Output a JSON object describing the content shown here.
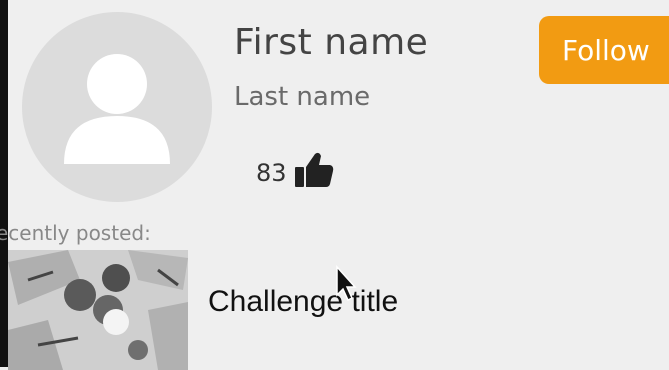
{
  "profile": {
    "first_name": "First name",
    "last_name": "Last name",
    "likes_count": "83"
  },
  "actions": {
    "follow_label": "Follow"
  },
  "recent": {
    "label": "ecently posted:",
    "challenge_title": "Challenge title"
  },
  "colors": {
    "accent": "#f29b12",
    "background": "#efefef",
    "avatar_bg": "#dcdcdc"
  },
  "icons": {
    "avatar": "user-silhouette-icon",
    "likes": "thumbs-up-icon",
    "cursor": "mouse-pointer-icon"
  }
}
